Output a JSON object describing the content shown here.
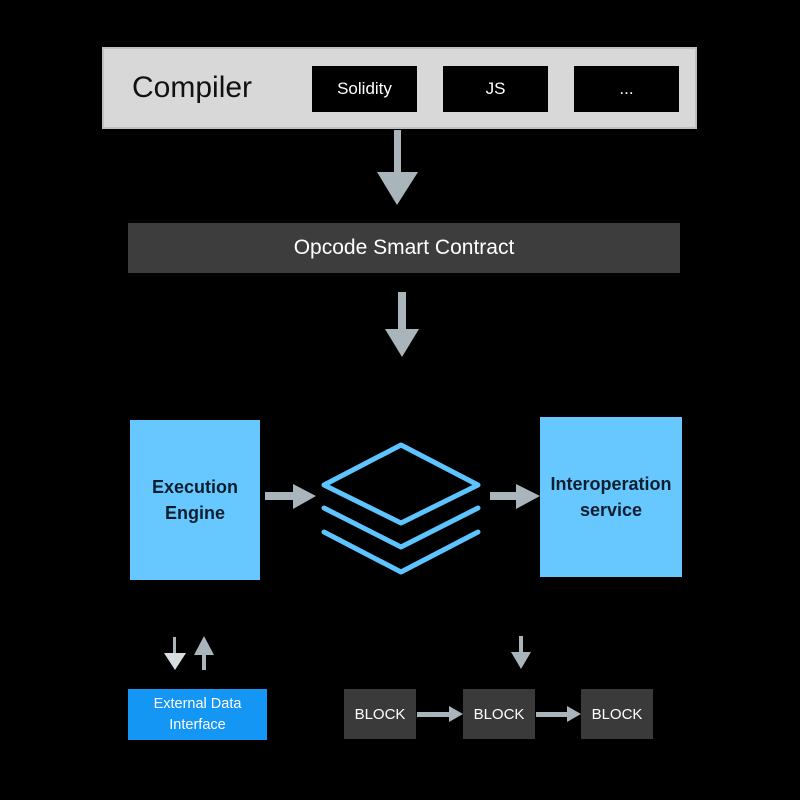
{
  "compiler": {
    "title": "Compiler",
    "languages": [
      "Solidity",
      "JS",
      "..."
    ]
  },
  "opcode": {
    "label": "Opcode Smart Contract"
  },
  "execution_engine": {
    "line1": "Execution",
    "line2": "Engine"
  },
  "interoperation": {
    "line1": "Interoperation",
    "line2": "service"
  },
  "stack_icon": "layers-icon",
  "external_data": {
    "line1": "External Data",
    "line2": "Interface"
  },
  "blocks": [
    "BLOCK",
    "BLOCK",
    "BLOCK"
  ],
  "colors": {
    "background": "#000000",
    "compiler_bg": "#d8d8d8",
    "bar_bg": "#3d3d3d",
    "light_blue": "#66c8ff",
    "accent_blue": "#1496f5",
    "arrow": "#a9b4bb",
    "block_bg": "#3a3a3a"
  }
}
